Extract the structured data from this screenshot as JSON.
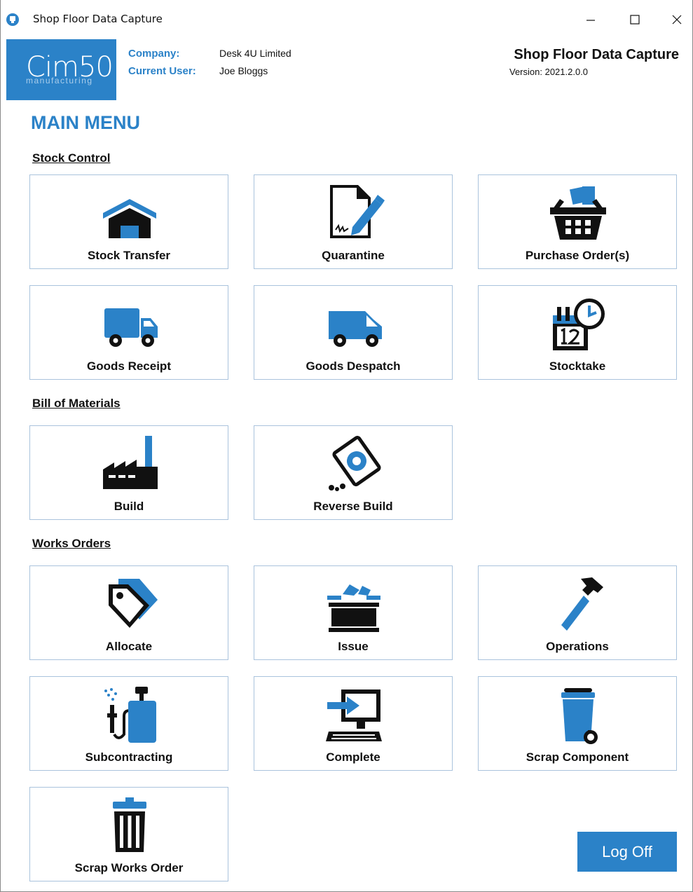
{
  "window": {
    "title": "Shop Floor Data Capture",
    "minimize": "—",
    "maximize": "☐",
    "close": "✕"
  },
  "logo": {
    "main": "Cim50",
    "sub": "manufacturing"
  },
  "info": {
    "company_label": "Company:",
    "company_value": "Desk 4U Limited",
    "user_label": "Current User:",
    "user_value": "Joe Bloggs"
  },
  "header": {
    "app_title": "Shop Floor Data Capture",
    "version": "Version: 2021.2.0.0"
  },
  "main_menu_title": "MAIN MENU",
  "sections": {
    "stock_control": "Stock Control",
    "bill_of_materials": "Bill of Materials",
    "works_orders": "Works Orders"
  },
  "tiles": {
    "stock_transfer": {
      "label": "Stock Transfer",
      "icon": "warehouse-icon"
    },
    "quarantine": {
      "label": "Quarantine",
      "icon": "signed-document-icon"
    },
    "purchase_orders": {
      "label": "Purchase Order(s)",
      "icon": "shopping-basket-icon"
    },
    "goods_receipt": {
      "label": "Goods Receipt",
      "icon": "truck-icon"
    },
    "goods_despatch": {
      "label": "Goods Despatch",
      "icon": "van-icon"
    },
    "stocktake": {
      "label": "Stocktake",
      "icon": "calendar-clock-icon"
    },
    "build": {
      "label": "Build",
      "icon": "factory-icon"
    },
    "reverse_build": {
      "label": "Reverse Build",
      "icon": "recycle-tablet-icon"
    },
    "allocate": {
      "label": "Allocate",
      "icon": "tags-icon"
    },
    "issue": {
      "label": "Issue",
      "icon": "open-box-icon"
    },
    "operations": {
      "label": "Operations",
      "icon": "hammer-icon"
    },
    "subcontracting": {
      "label": "Subcontracting",
      "icon": "sprayer-icon"
    },
    "complete": {
      "label": "Complete",
      "icon": "computer-login-icon"
    },
    "scrap_component": {
      "label": "Scrap Component",
      "icon": "wheelie-bin-icon"
    },
    "scrap_works_order": {
      "label": "Scrap Works Order",
      "icon": "trash-can-icon"
    }
  },
  "logoff_label": "Log Off",
  "colors": {
    "accent": "#2b82c8",
    "tile_border": "#aac3dd",
    "icon_dark": "#111111"
  }
}
